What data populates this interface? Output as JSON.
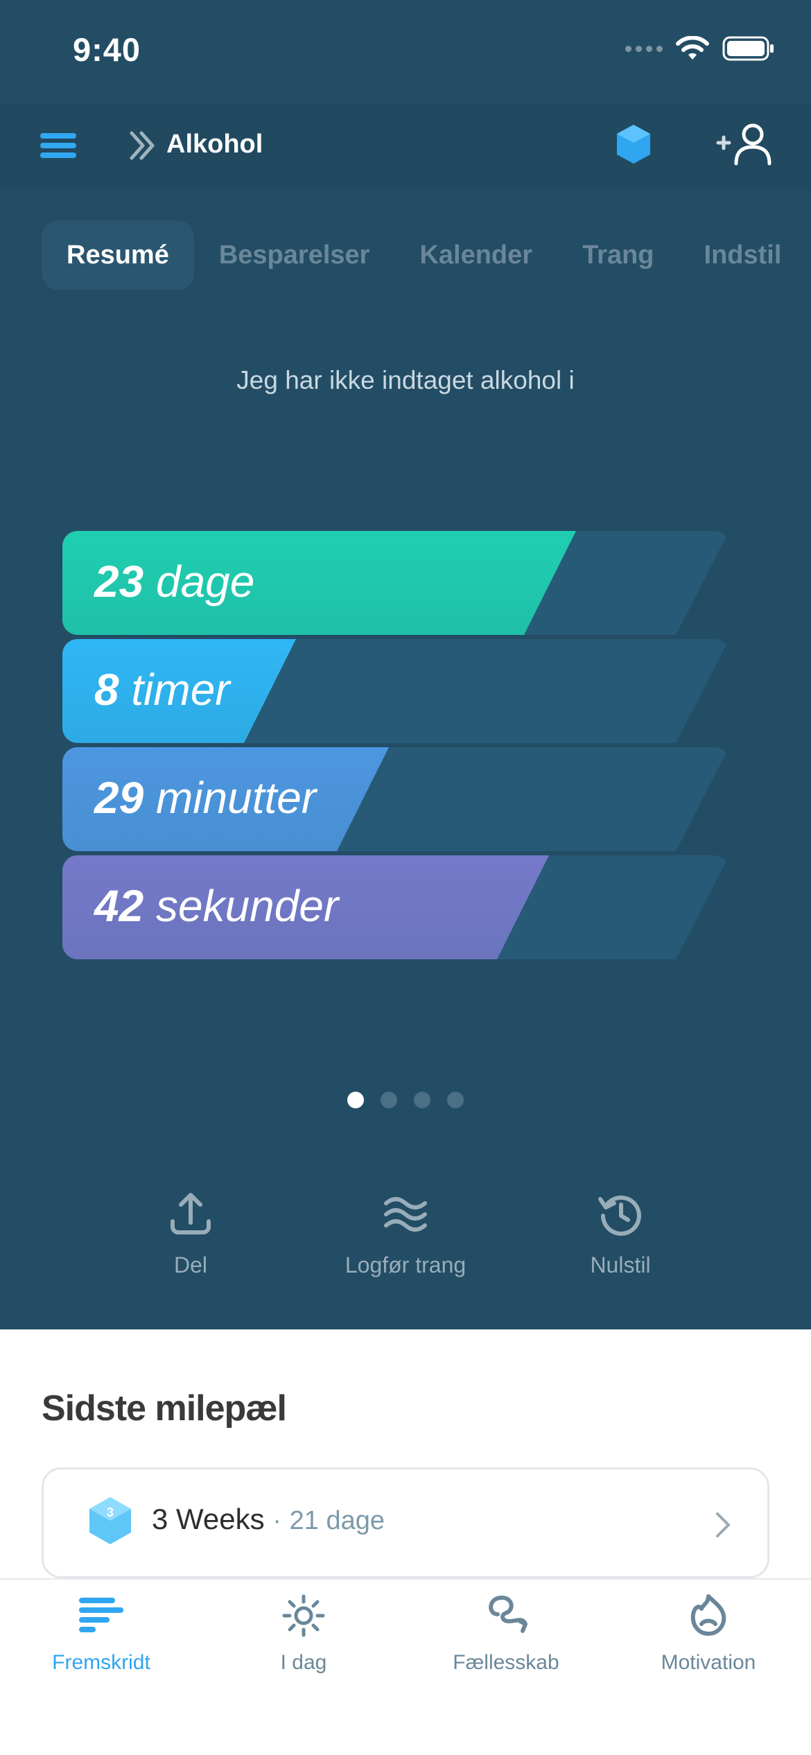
{
  "status": {
    "time": "9:40"
  },
  "header": {
    "title": "Alkohol"
  },
  "tabs": [
    {
      "label": "Resumé",
      "active": true
    },
    {
      "label": "Besparelser"
    },
    {
      "label": "Kalender"
    },
    {
      "label": "Trang"
    },
    {
      "label": "Indstil"
    }
  ],
  "summary": {
    "lead": "Jeg har ikke indtaget alkohol i",
    "bars": [
      {
        "value": "23",
        "unit": "dage",
        "fill_fraction": 0.77,
        "color": "#1fcfb0"
      },
      {
        "value": "8",
        "unit": "timer",
        "fill_fraction": 0.35,
        "color": "#2fb7f5"
      },
      {
        "value": "29",
        "unit": "minutter",
        "fill_fraction": 0.49,
        "color": "#4d97e0"
      },
      {
        "value": "42",
        "unit": "sekunder",
        "fill_fraction": 0.73,
        "color": "#7579c9"
      }
    ],
    "page_count": 4,
    "current_page": 1
  },
  "actions": {
    "share": "Del",
    "log_urge": "Logfør trang",
    "reset": "Nulstil"
  },
  "milestone": {
    "section_title": "Sidste milepæl",
    "badge_number": "3",
    "title": "3 Weeks",
    "separator": "·",
    "subtitle": "21 dage"
  },
  "tabbar": {
    "progress": "Fremskridt",
    "today": "I dag",
    "community": "Fællesskab",
    "motivation": "Motivation"
  },
  "colors": {
    "accent": "#2fa6ef",
    "header_bg": "#234d65"
  }
}
